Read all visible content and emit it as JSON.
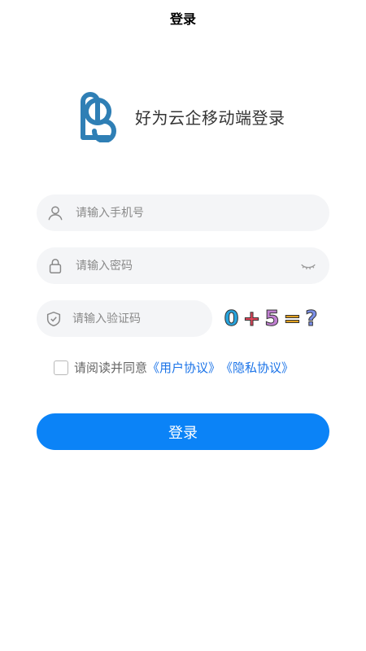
{
  "header": {
    "title": "登录"
  },
  "brand": {
    "logo_icon": "app-logo-icon",
    "name": "好为云企移动端登录",
    "logo_color": "#2f7fb5"
  },
  "form": {
    "phone": {
      "placeholder": "请输入手机号",
      "value": "",
      "icon": "user-icon"
    },
    "password": {
      "placeholder": "请输入密码",
      "value": "",
      "icon": "lock-icon",
      "toggle_icon": "eye-closed-icon"
    },
    "code": {
      "placeholder": "请输入验证码",
      "value": "",
      "icon": "shield-check-icon"
    },
    "captcha": {
      "chars": [
        "0",
        "+",
        "5",
        "=",
        "?"
      ],
      "colors": [
        "#27a3dc",
        "#e2455a",
        "#c07fd1",
        "#e0a020",
        "#7b8fe8"
      ]
    }
  },
  "agreement": {
    "checked": false,
    "prefix": "请阅读并同意",
    "user_agreement": "《用户协议》",
    "privacy_policy": "《隐私协议》",
    "link_color": "#1a73e8"
  },
  "login_button": {
    "label": "登录",
    "color": "#0b83f7"
  }
}
